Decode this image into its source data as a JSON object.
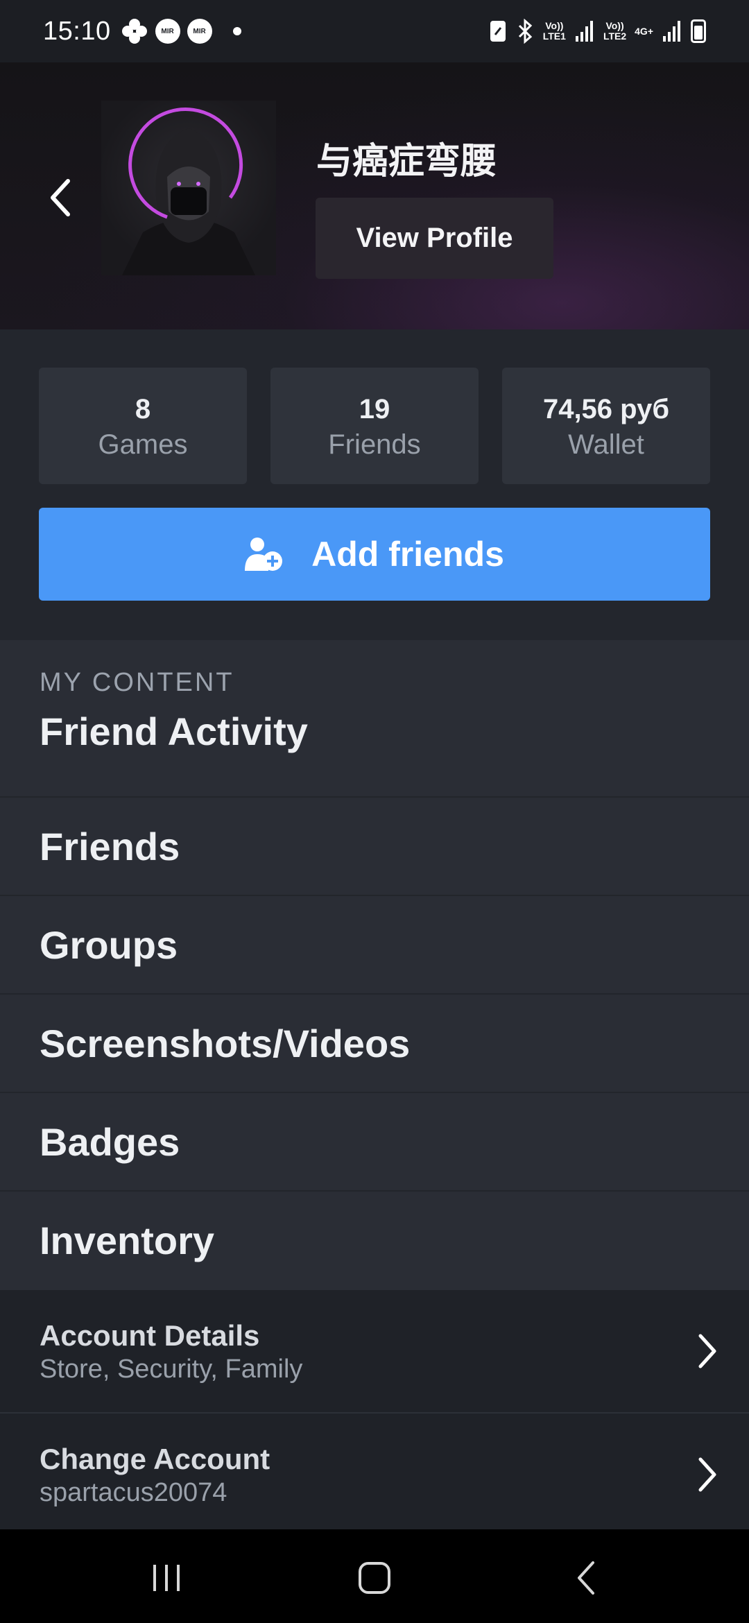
{
  "status_bar": {
    "time": "15:10",
    "notification_icons": [
      "clover-icon",
      "mir-icon",
      "mir-icon",
      "dot-icon"
    ],
    "mir_label": "MIR",
    "sim1_label_top": "Vo))",
    "sim1_label_bottom": "LTE1",
    "sim2_label_top": "Vo))",
    "sim2_label_bottom": "LTE2",
    "network_type": "4G+"
  },
  "profile": {
    "username": "与癌症弯腰",
    "view_profile_label": "View Profile"
  },
  "stats": [
    {
      "value": "8",
      "label": "Games"
    },
    {
      "value": "19",
      "label": "Friends"
    },
    {
      "value": "74,56 руб",
      "label": "Wallet"
    }
  ],
  "add_friends_label": "Add friends",
  "my_content": {
    "section_label": "MY CONTENT",
    "items": [
      {
        "label": "Friend Activity"
      },
      {
        "label": "Friends"
      },
      {
        "label": "Groups"
      },
      {
        "label": "Screenshots/Videos"
      },
      {
        "label": "Badges"
      },
      {
        "label": "Inventory"
      }
    ]
  },
  "account": [
    {
      "title": "Account Details",
      "subtitle": "Store, Security, Family"
    },
    {
      "title": "Change Account",
      "subtitle": "spartacus20074"
    }
  ],
  "colors": {
    "accent_blue": "#4a98f7",
    "background": "#2a2d35",
    "avatar_ring": "#c44be0"
  }
}
